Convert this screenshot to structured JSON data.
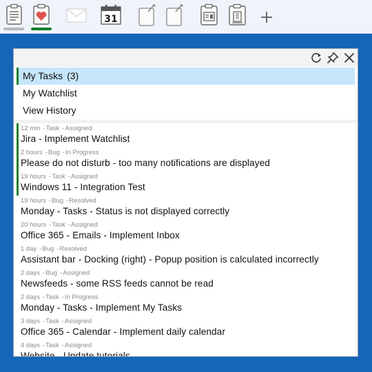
{
  "toolbar": {
    "icons": [
      "document-icon",
      "heart-clipboard-icon",
      "mail-icon",
      "calendar-icon",
      "note-icon",
      "note-icon",
      "newspaper-icon",
      "building-icon",
      "plus-icon"
    ],
    "calendar_day": "31",
    "plus_label": "+"
  },
  "panel": {
    "menu": [
      {
        "label": "My Tasks",
        "count": "(3)",
        "active": true
      },
      {
        "label": "My Watchlist",
        "count": ""
      },
      {
        "label": "View History",
        "count": ""
      }
    ],
    "tasks": [
      {
        "time": "12 min",
        "type": "Task",
        "status": "Assigned",
        "title": "Jira - Implement Watchlist",
        "flag": true
      },
      {
        "time": "2 hours",
        "type": "Bug",
        "status": "In Progress",
        "title": "Please do not disturb - too many notifications are displayed",
        "flag": true
      },
      {
        "time": "19 hours",
        "type": "Task",
        "status": "Assigned",
        "title": "Windows 11 - Integration Test",
        "flag": true
      },
      {
        "time": "19 hours",
        "type": "Bug",
        "status": "Resolved",
        "title": "Monday - Tasks - Status is not displayed correctly",
        "flag": false
      },
      {
        "time": "20 hours",
        "type": "Task",
        "status": "Assigned",
        "title": "Office 365 - Emails - Implement Inbox",
        "flag": false
      },
      {
        "time": "1 day",
        "type": "Bug",
        "status": "Resolved",
        "title": "Assistant bar - Docking (right) - Popup position is calculated incorrectly",
        "flag": false
      },
      {
        "time": "2 days",
        "type": "Bug",
        "status": "Assigned",
        "title": "Newsfeeds - some RSS feeds cannot be read",
        "flag": false
      },
      {
        "time": "2 days",
        "type": "Task",
        "status": "In Progress",
        "title": "Monday - Tasks - Implement My Tasks",
        "flag": false
      },
      {
        "time": "3 days",
        "type": "Task",
        "status": "Assigned",
        "title": "Office 365 - Calendar - Implement daily calendar",
        "flag": false
      },
      {
        "time": "4 days",
        "type": "Task",
        "status": "Assigned",
        "title": "Website - Update tutorials",
        "flag": false
      }
    ]
  },
  "colors": {
    "background": "#1565b8",
    "active_indicator": "#1a7f2a",
    "selected_row": "#c5e6fb"
  }
}
